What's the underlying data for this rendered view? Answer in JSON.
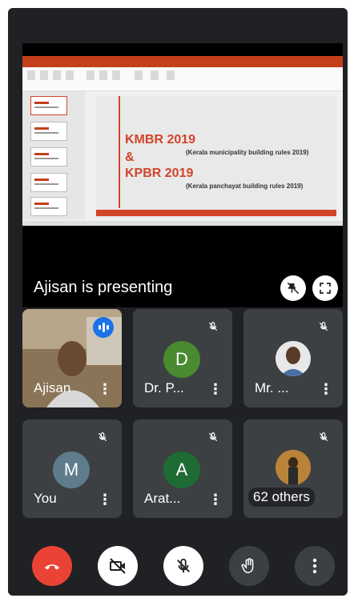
{
  "presentation": {
    "slide_title_1": "KMBR 2019",
    "slide_amp": "&",
    "slide_title_2": "KPBR 2019",
    "slide_sub_1": "(Kerala municipality building rules 2019)",
    "slide_sub_2": "(Kerala panchayat building rules 2019)",
    "presenting_label": "Ajisan is presenting"
  },
  "participants": [
    {
      "name": "Ajisan",
      "type": "video",
      "speaking": true
    },
    {
      "name": "Dr. P...",
      "initial": "D",
      "avatar_color": "#4a8a30",
      "muted": true
    },
    {
      "name": "Mr. ...",
      "type": "photo",
      "muted": true
    },
    {
      "name": "You",
      "initial": "M",
      "avatar_color": "#5f7c8c",
      "muted": true
    },
    {
      "name": "Arat...",
      "initial": "A",
      "avatar_color": "#1e6b34",
      "muted": true
    },
    {
      "name": "62 others",
      "type": "others",
      "muted": true
    }
  ],
  "controls": {
    "end_call": "end-call",
    "camera": "camera-off",
    "mic": "mic-off",
    "hand": "raise-hand",
    "more": "more-options"
  },
  "colors": {
    "background": "#202124",
    "tile": "#3c4043",
    "end_call": "#ea4335",
    "accent": "#1a73e8",
    "slide_accent": "#d2442a"
  }
}
